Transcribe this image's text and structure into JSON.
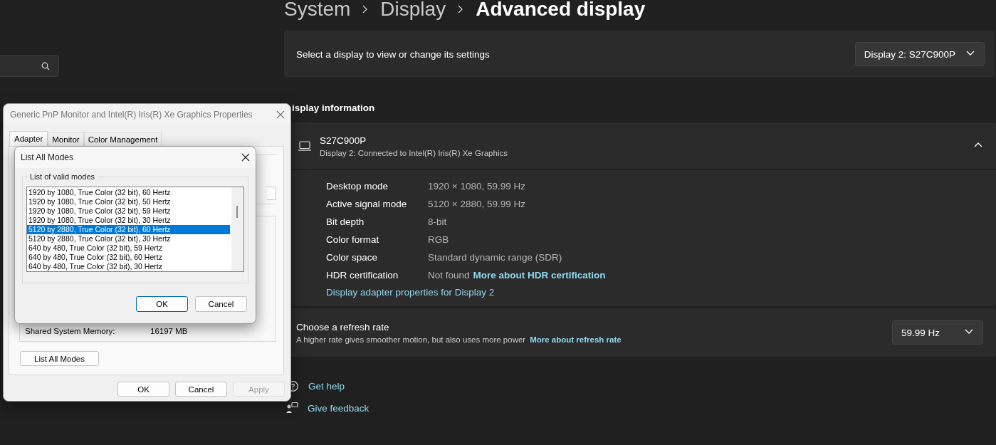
{
  "breadcrumb": [
    {
      "label": "System",
      "current": false
    },
    {
      "label": "Display",
      "current": false
    },
    {
      "label": "Advanced display",
      "current": true
    }
  ],
  "display_select": {
    "label": "Select a display to view or change its settings",
    "value": "Display 2: S27C900P"
  },
  "display_info": {
    "heading": "isplay information",
    "name": "S27C900P",
    "subtitle": "Display 2: Connected to Intel(R) Iris(R) Xe Graphics",
    "expanded": true,
    "rows": [
      {
        "label": "Desktop mode",
        "value": "1920 × 1080, 59.99 Hz"
      },
      {
        "label": "Active signal mode",
        "value": "5120 × 2880, 59.99 Hz"
      },
      {
        "label": "Bit depth",
        "value": "8-bit"
      },
      {
        "label": "Color format",
        "value": "RGB"
      },
      {
        "label": "Color space",
        "value": "Standard dynamic range (SDR)"
      },
      {
        "label": "HDR certification",
        "value": "Not found",
        "link": "More about HDR certification"
      }
    ],
    "adapter_link": "Display adapter properties for Display 2"
  },
  "refresh_rate": {
    "title": "Choose a refresh rate",
    "description": "A higher rate gives smoother motion, but also uses more power",
    "link": "More about refresh rate",
    "value": "59.99 Hz"
  },
  "help_links": [
    {
      "kind": "help",
      "label": "Get help"
    },
    {
      "kind": "feedback",
      "label": "Give feedback"
    }
  ],
  "properties_dialog": {
    "title": "Generic PnP Monitor and Intel(R) Iris(R) Xe Graphics Properties",
    "tabs": [
      {
        "label": "Adapter",
        "selected": true
      },
      {
        "label": "Monitor",
        "selected": false
      },
      {
        "label": "Color Management",
        "selected": false
      }
    ],
    "memory_label": "Shared System Memory:",
    "memory_value": "16197 MB",
    "list_modes_button": "List All Modes",
    "buttons": [
      {
        "label": "OK",
        "disabled": false
      },
      {
        "label": "Cancel",
        "disabled": false
      },
      {
        "label": "Apply",
        "disabled": true
      }
    ]
  },
  "modes_dialog": {
    "title": "List All Modes",
    "group_label": "List of valid modes",
    "modes": [
      {
        "label": "1920 by 1080, True Color (32 bit), 60 Hertz",
        "selected": false
      },
      {
        "label": "1920 by 1080, True Color (32 bit), 50 Hertz",
        "selected": false
      },
      {
        "label": "1920 by 1080, True Color (32 bit), 59 Hertz",
        "selected": false
      },
      {
        "label": "1920 by 1080, True Color (32 bit), 30 Hertz",
        "selected": false
      },
      {
        "label": "5120 by 2880, True Color (32 bit), 60 Hertz",
        "selected": true
      },
      {
        "label": "5120 by 2880, True Color (32 bit), 30 Hertz",
        "selected": false
      },
      {
        "label": "640 by 480, True Color (32 bit), 59 Hertz",
        "selected": false
      },
      {
        "label": "640 by 480, True Color (32 bit), 60 Hertz",
        "selected": false
      },
      {
        "label": "640 by 480, True Color (32 bit), 30 Hertz",
        "selected": false
      }
    ],
    "buttons": [
      {
        "label": "OK",
        "default": true
      },
      {
        "label": "Cancel",
        "default": false
      }
    ]
  }
}
